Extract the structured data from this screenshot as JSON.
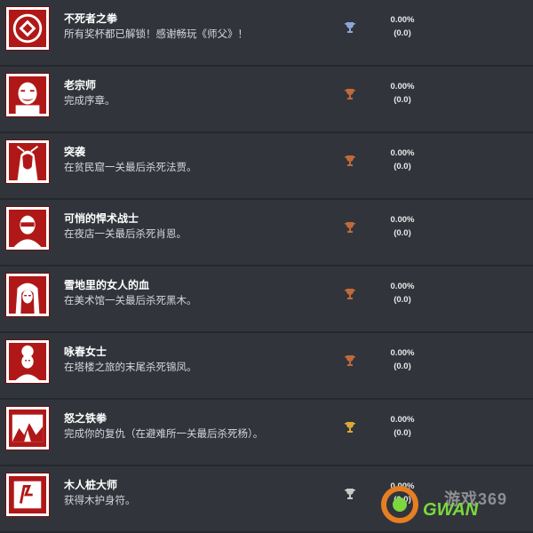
{
  "trophies": [
    {
      "title": "不死者之拳",
      "description": "所有奖杯都已解锁！感谢畅玩《师父》！",
      "trophy_icon": "platinum-trophy-icon",
      "trophy_color": "#8aa6d8",
      "percent": "0.00%",
      "count": "(0.0)",
      "image_icon": "seal-icon"
    },
    {
      "title": "老宗师",
      "description": "完成序章。",
      "trophy_icon": "bronze-trophy-icon",
      "trophy_color": "#c0693a",
      "percent": "0.00%",
      "count": "(0.0)",
      "image_icon": "old-master-portrait-icon"
    },
    {
      "title": "突袭",
      "description": "在贫民窟一关最后杀死法贾。",
      "trophy_icon": "bronze-trophy-icon",
      "trophy_color": "#c0693a",
      "percent": "0.00%",
      "count": "(0.0)",
      "image_icon": "fajar-portrait-icon"
    },
    {
      "title": "可悄的悍术战士",
      "description": "在夜店一关最后杀死肖恩。",
      "trophy_icon": "bronze-trophy-icon",
      "trophy_color": "#c0693a",
      "percent": "0.00%",
      "count": "(0.0)",
      "image_icon": "sean-portrait-icon"
    },
    {
      "title": "雪地里的女人的血",
      "description": "在美术馆一关最后杀死黑木。",
      "trophy_icon": "bronze-trophy-icon",
      "trophy_color": "#c0693a",
      "percent": "0.00%",
      "count": "(0.0)",
      "image_icon": "kuroki-portrait-icon"
    },
    {
      "title": "咏春女士",
      "description": "在塔楼之旅的末尾杀死锦凤。",
      "trophy_icon": "bronze-trophy-icon",
      "trophy_color": "#c0693a",
      "percent": "0.00%",
      "count": "(0.0)",
      "image_icon": "jinfeng-portrait-icon"
    },
    {
      "title": "怒之铁拳",
      "description": "完成你的复仇（在避难所一关最后杀死杨）。",
      "trophy_icon": "gold-trophy-icon",
      "trophy_color": "#d8a838",
      "percent": "0.00%",
      "count": "(0.0)",
      "image_icon": "yang-portrait-icon"
    },
    {
      "title": "木人桩大师",
      "description": "获得木护身符。",
      "trophy_icon": "silver-trophy-icon",
      "trophy_color": "#c9c9c9",
      "percent": "0.00%",
      "count": "(0.0)",
      "image_icon": "wooden-dummy-icon"
    }
  ],
  "watermark": {
    "text": "游戏369",
    "sub": "GWAN"
  }
}
